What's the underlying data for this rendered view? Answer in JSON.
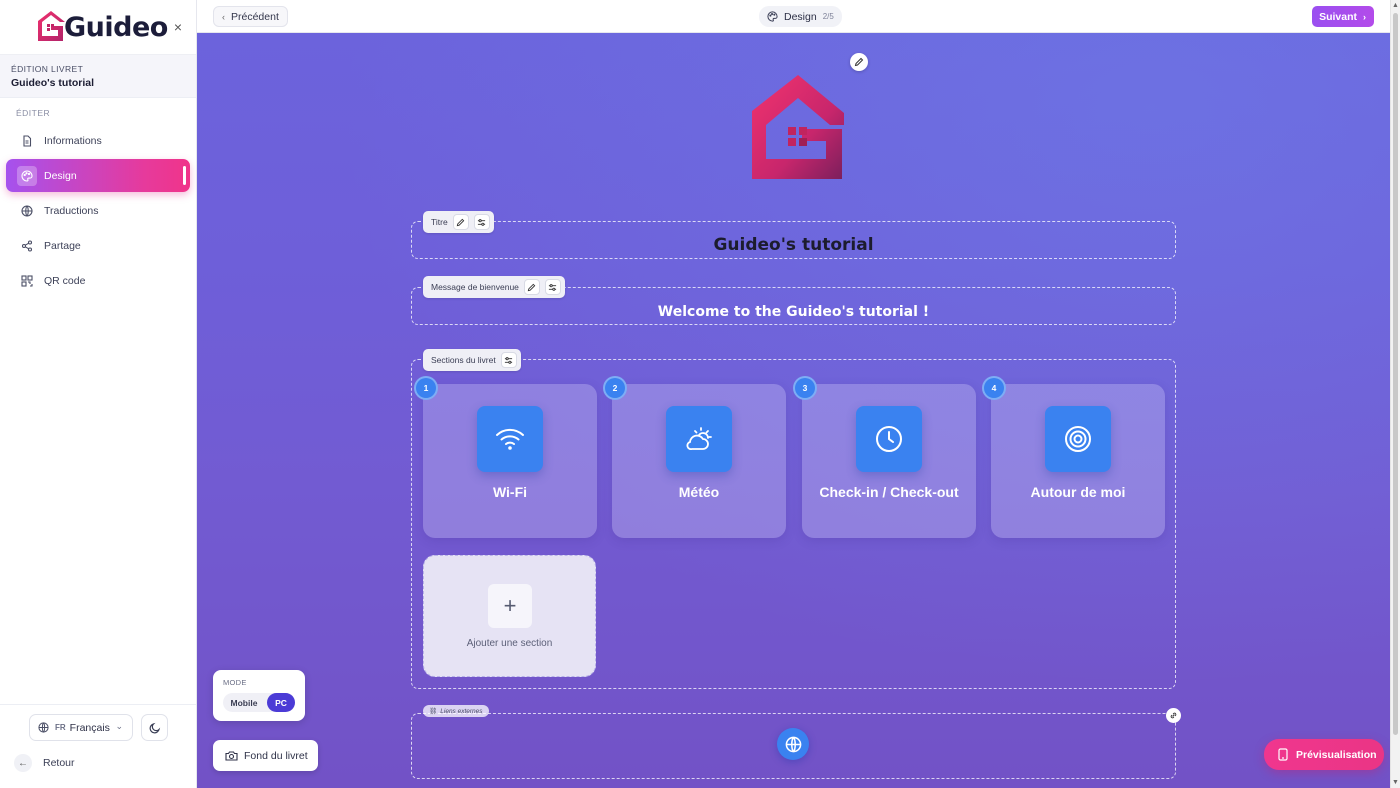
{
  "sidebar": {
    "logo_text": "Guideo",
    "close_label": "×",
    "booklet_label": "ÉDITION LIVRET",
    "booklet_name": "Guideo's tutorial",
    "section_title": "ÉDITER",
    "items": [
      {
        "label": "Informations",
        "icon": "document-icon"
      },
      {
        "label": "Design",
        "icon": "palette-icon",
        "active": true
      },
      {
        "label": "Traductions",
        "icon": "globe-icon"
      },
      {
        "label": "Partage",
        "icon": "share-icon"
      },
      {
        "label": "QR code",
        "icon": "qrcode-icon"
      }
    ],
    "language": {
      "code": "FR",
      "label": "Français"
    },
    "back_label": "Retour"
  },
  "topbar": {
    "prev_label": "Précédent",
    "step_label": "Design",
    "step_count": "2/5",
    "next_label": "Suivant"
  },
  "editor": {
    "title_tag": "Titre",
    "title_text": "Guideo's tutorial",
    "welcome_tag": "Message de bienvenue",
    "welcome_text": "Welcome to the Guideo's tutorial !",
    "sections_tag": "Sections du livret",
    "sections": [
      {
        "number": "1",
        "label": "Wi-Fi",
        "icon": "wifi-icon"
      },
      {
        "number": "2",
        "label": "Météo",
        "icon": "weather-icon"
      },
      {
        "number": "3",
        "label": "Check-in / Check-out",
        "icon": "clock-icon"
      },
      {
        "number": "4",
        "label": "Autour de moi",
        "icon": "target-icon"
      }
    ],
    "add_section_label": "Ajouter une section",
    "external_links_tag": "Liens externes"
  },
  "mode": {
    "label": "MODE",
    "options": [
      "Mobile",
      "PC"
    ],
    "selected": "PC"
  },
  "background_button": "Fond du livret",
  "preview_button": "Prévisualisation",
  "colors": {
    "accent_pink": "#ea3585",
    "accent_purple": "#9a4ff0",
    "section_blue": "#3a82f0",
    "canvas_bg": "#6e5fd9"
  }
}
